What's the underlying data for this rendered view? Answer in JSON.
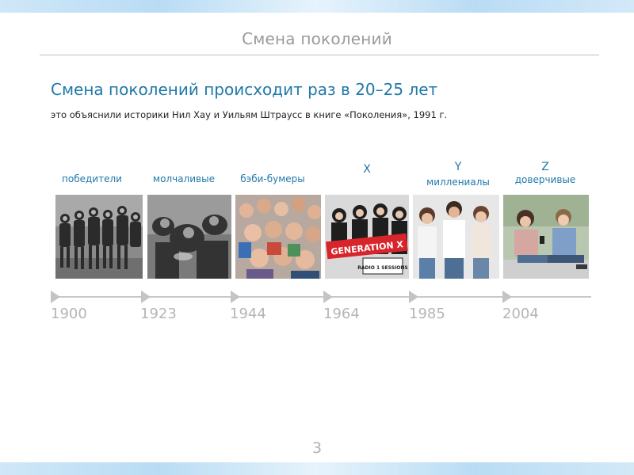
{
  "slide": {
    "header_title": "Смена поколений",
    "headline": "Смена поколений происходит раз в 20–25 лет",
    "subline": "это объяснили историки Нил Хау и Уильям Штраусс в книге «Поколения», 1991 г.",
    "page_number": "3"
  },
  "generations": [
    {
      "letter": "",
      "label": "победители",
      "year": "1900",
      "photo": "black-and-white group of children"
    },
    {
      "letter": "",
      "label": "молчаливые",
      "year": "1923",
      "photo": "black-and-white people in a crowd"
    },
    {
      "letter": "",
      "label": "бэби-бумеры",
      "year": "1944",
      "photo": "crowd of cheering adults"
    },
    {
      "letter": "X",
      "label": "",
      "year": "1964",
      "photo": "band members with a red sign",
      "photo_sign": "GENERATION X",
      "photo_caption": "RADIO 1 SESSIONS"
    },
    {
      "letter": "Y",
      "label": "миллениалы",
      "year": "1985",
      "photo": "smiling young adults"
    },
    {
      "letter": "Z",
      "label": "доверчивые",
      "year": "2004",
      "photo": "teenagers with smartphones"
    }
  ],
  "colors": {
    "accent": "#1f78a8",
    "year": "#b5b5b5",
    "timeline": "#c8c8c8",
    "band": "#b9dcf4"
  }
}
